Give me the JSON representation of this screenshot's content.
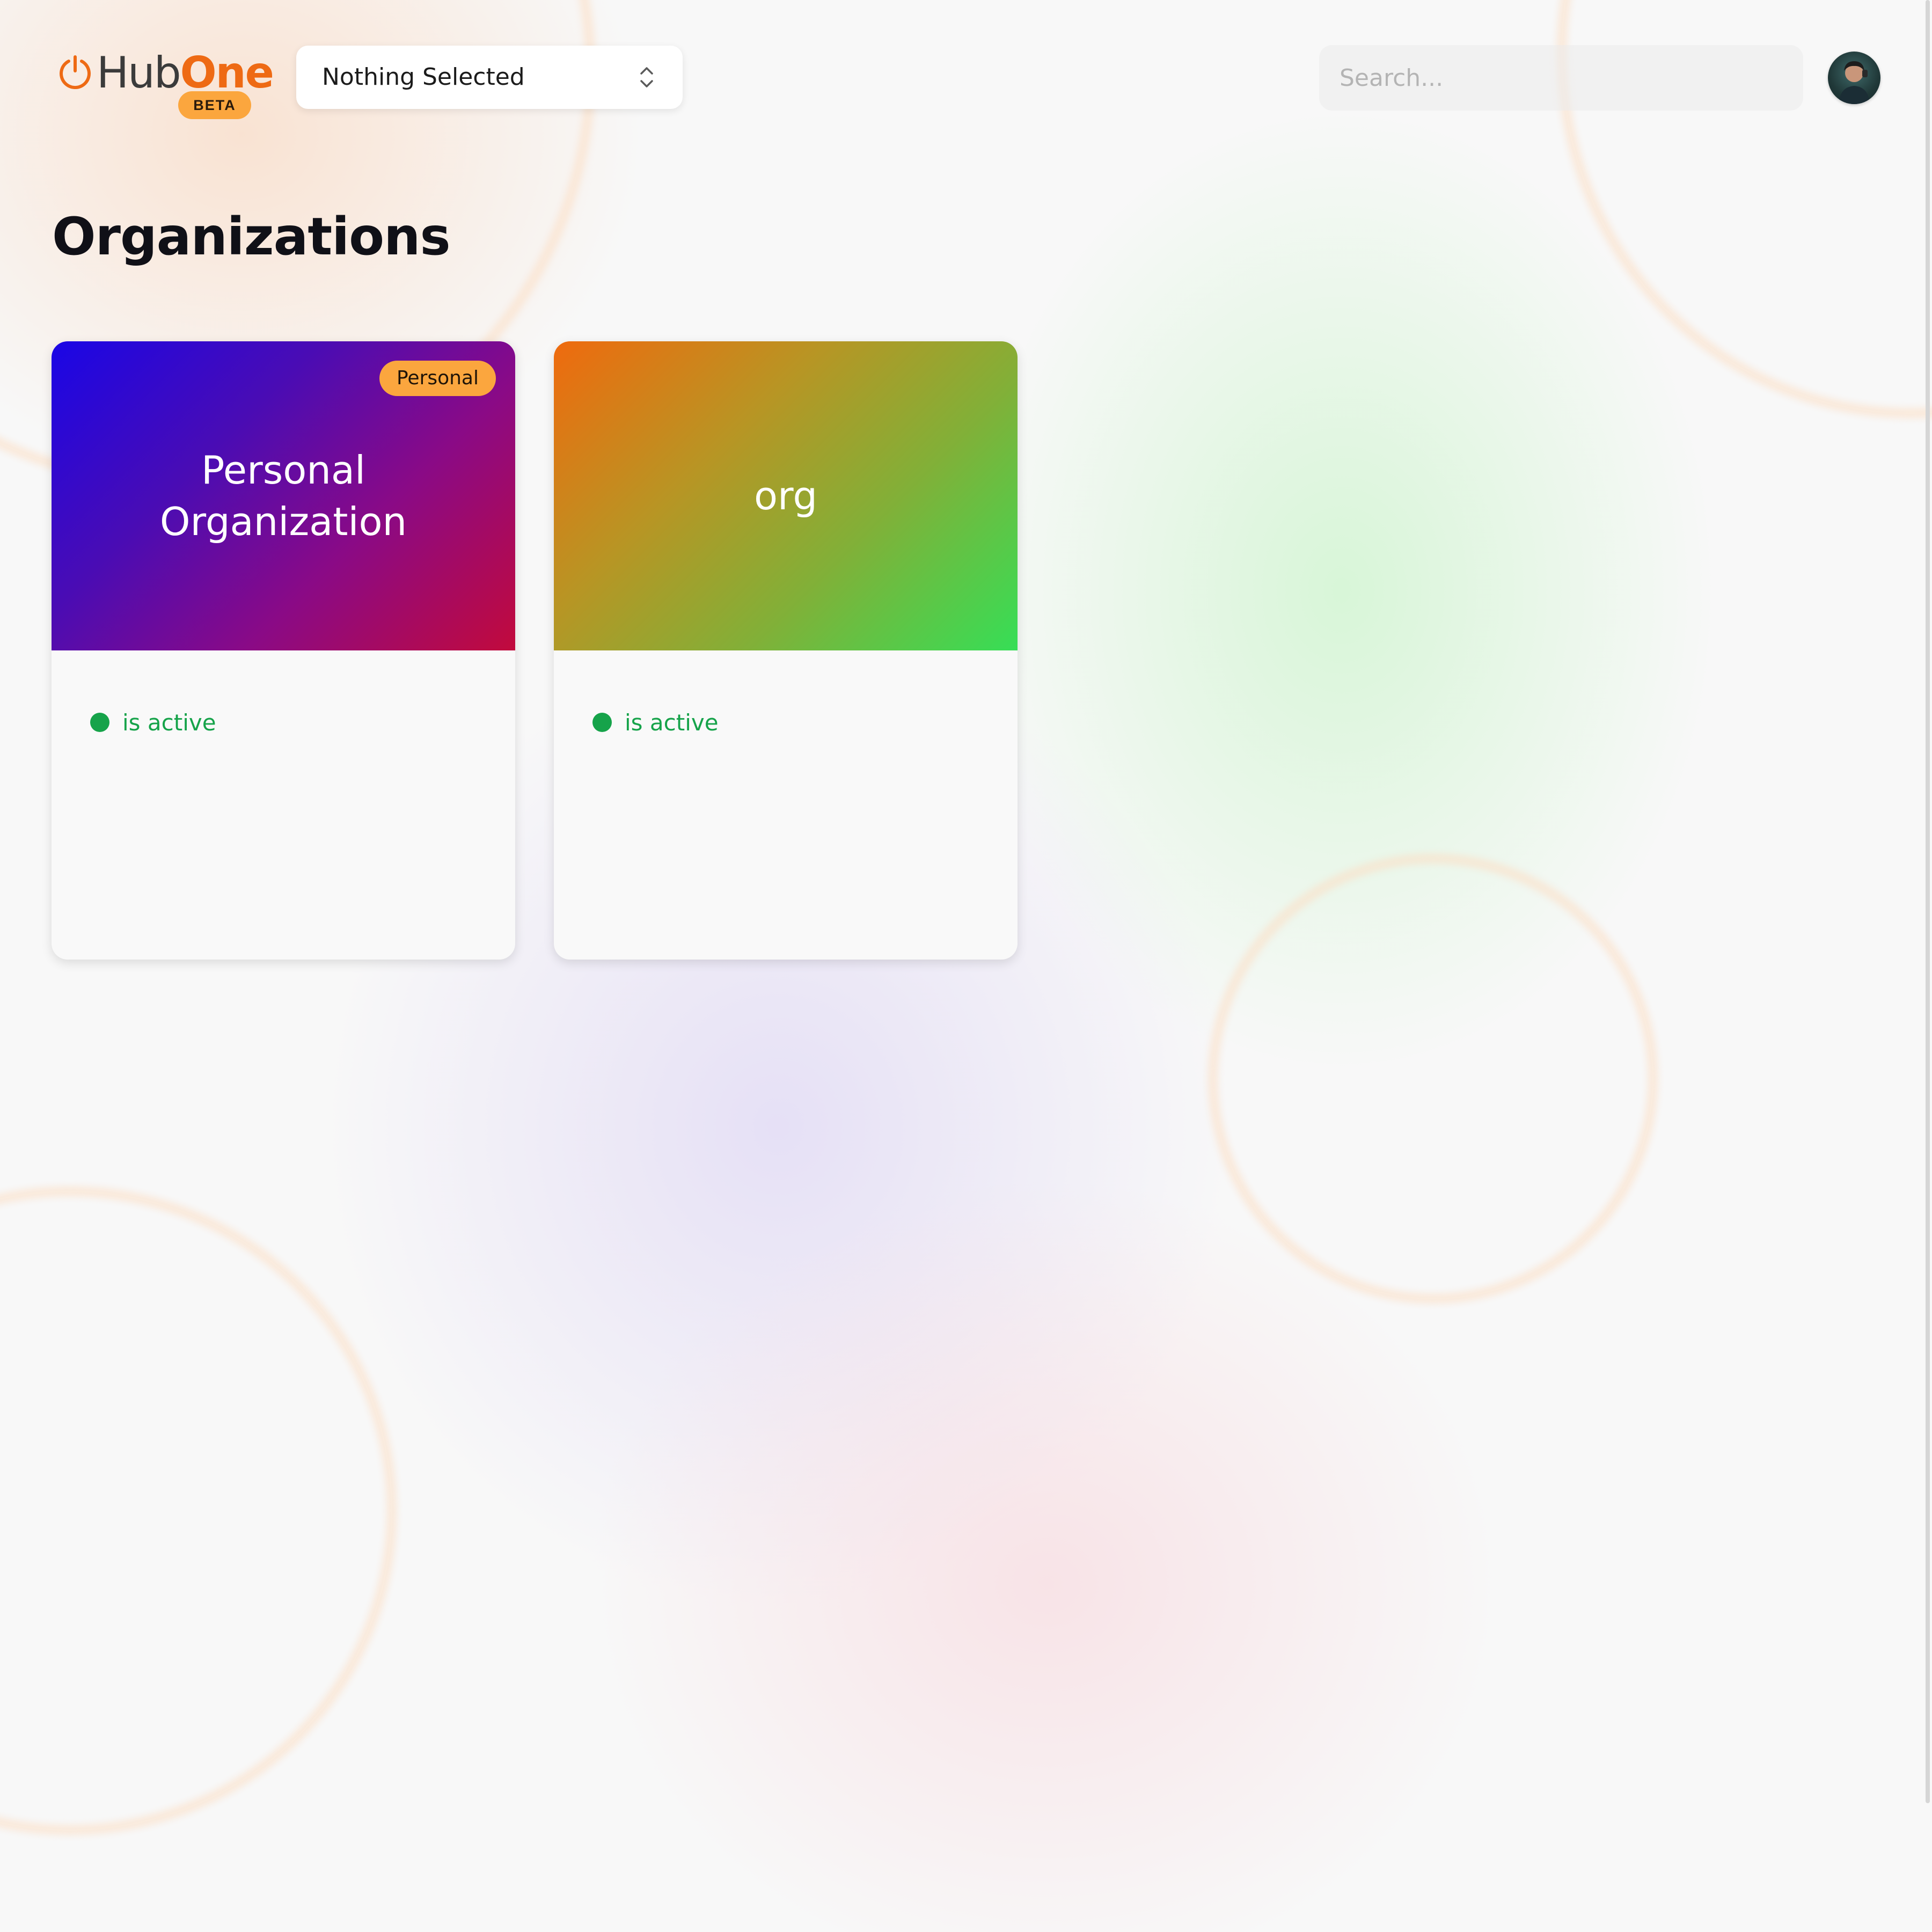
{
  "brand": {
    "name_part1": "Hub",
    "name_part2": "One",
    "badge": "BETA",
    "accent_color": "#ee6a14",
    "badge_color": "#fba63e"
  },
  "header": {
    "org_selector": {
      "selected_value": "Nothing Selected",
      "icon": "chevron-up-down-icon"
    },
    "search": {
      "placeholder": "Search...",
      "value": ""
    },
    "avatar": {
      "icon": "user-avatar"
    }
  },
  "main": {
    "title": "Organizations",
    "organizations": [
      {
        "name": "Personal Organization",
        "tag": "Personal",
        "status": "is active",
        "status_color": "#16a34a",
        "banner_gradient": [
          "#1a06e6",
          "#c20a3c"
        ]
      },
      {
        "name": "org",
        "tag": "",
        "status": "is active",
        "status_color": "#16a34a",
        "banner_gradient": [
          "#ef6a0e",
          "#36de56"
        ]
      }
    ]
  }
}
